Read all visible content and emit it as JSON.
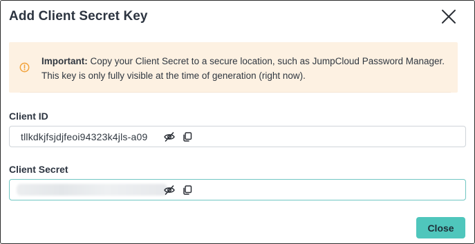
{
  "dialog": {
    "title": "Add Client Secret Key"
  },
  "alert": {
    "strong": "Important:",
    "message": " Copy your Client Secret to a secure location, such as JumpCloud Password Manager. This key is only fully visible at the time of generation (right now).",
    "icon": "warning-circle-icon",
    "background_color": "#fdf1e2",
    "icon_color": "#f2a23a"
  },
  "fields": {
    "client_id": {
      "label": "Client ID",
      "value": "tllkdkjfsjdjfeoi94323k4jls-a09"
    },
    "client_secret": {
      "label": "Client Secret",
      "masked": true
    }
  },
  "icons": {
    "visibility": "eye-slash-icon",
    "copy": "copy-icon",
    "close": "close-icon"
  },
  "footer": {
    "close_label": "Close"
  },
  "colors": {
    "accent": "#4fc6bc",
    "focus_border": "#6fc6c2",
    "text_dark": "#2c3440"
  }
}
